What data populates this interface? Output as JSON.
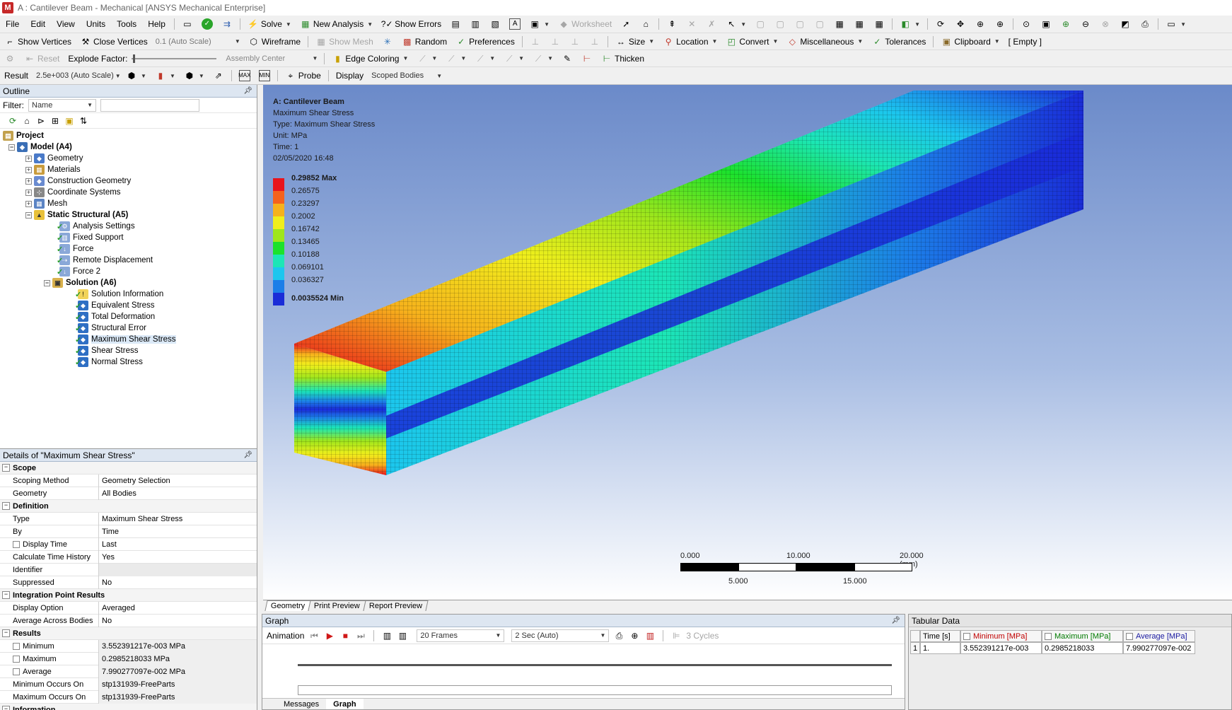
{
  "window": {
    "title": "A : Cantilever Beam - Mechanical [ANSYS Mechanical Enterprise]",
    "logo": "M"
  },
  "menubar": [
    "File",
    "Edit",
    "View",
    "Units",
    "Tools",
    "Help"
  ],
  "toolbar1": {
    "solve": "Solve",
    "new_analysis": "New Analysis",
    "show_errors": "Show Errors",
    "worksheet": "Worksheet"
  },
  "toolbar2": {
    "show_vertices": "Show Vertices",
    "close_vertices": "Close Vertices",
    "scale": "0.1 (Auto Scale)",
    "wireframe": "Wireframe",
    "show_mesh": "Show Mesh",
    "random": "Random",
    "preferences": "Preferences",
    "size": "Size",
    "location": "Location",
    "convert": "Convert",
    "misc": "Miscellaneous",
    "tolerances": "Tolerances",
    "clipboard": "Clipboard",
    "empty": "[ Empty ]"
  },
  "toolbar3": {
    "reset": "Reset",
    "explode_factor": "Explode Factor:",
    "assembly_center": "Assembly Center",
    "edge_coloring": "Edge Coloring",
    "thicken": "Thicken"
  },
  "toolbar4": {
    "result_label": "Result",
    "result_scale": "2.5e+003 (Auto Scale)",
    "probe": "Probe",
    "display_label": "Display",
    "display_value": "Scoped Bodies"
  },
  "outline": {
    "header": "Outline",
    "filter_label": "Filter:",
    "filter_value": "Name",
    "tree": {
      "project": "Project",
      "model": "Model (A4)",
      "geometry": "Geometry",
      "materials": "Materials",
      "construction_geometry": "Construction Geometry",
      "coordinate_systems": "Coordinate Systems",
      "mesh": "Mesh",
      "static_structural": "Static Structural (A5)",
      "analysis_settings": "Analysis Settings",
      "fixed_support": "Fixed Support",
      "force": "Force",
      "remote_displacement": "Remote Displacement",
      "force2": "Force 2",
      "solution": "Solution (A6)",
      "solution_information": "Solution Information",
      "equivalent_stress": "Equivalent Stress",
      "total_deformation": "Total Deformation",
      "structural_error": "Structural Error",
      "maximum_shear_stress": "Maximum Shear Stress",
      "shear_stress": "Shear Stress",
      "normal_stress": "Normal Stress"
    }
  },
  "details": {
    "header": "Details of \"Maximum Shear Stress\"",
    "scope": "Scope",
    "scoping_method_k": "Scoping Method",
    "scoping_method_v": "Geometry Selection",
    "geometry_k": "Geometry",
    "geometry_v": "All Bodies",
    "definition": "Definition",
    "type_k": "Type",
    "type_v": "Maximum Shear Stress",
    "by_k": "By",
    "by_v": "Time",
    "display_time_k": "Display Time",
    "display_time_v": "Last",
    "calc_history_k": "Calculate Time History",
    "calc_history_v": "Yes",
    "identifier_k": "Identifier",
    "identifier_v": "",
    "suppressed_k": "Suppressed",
    "suppressed_v": "No",
    "ipr": "Integration Point Results",
    "display_option_k": "Display Option",
    "display_option_v": "Averaged",
    "avg_across_k": "Average Across Bodies",
    "avg_across_v": "No",
    "results": "Results",
    "minimum_k": "Minimum",
    "minimum_v": "3.552391217e-003 MPa",
    "maximum_k": "Maximum",
    "maximum_v": "0.2985218033 MPa",
    "average_k": "Average",
    "average_v": "7.990277097e-002 MPa",
    "min_occurs_k": "Minimum Occurs On",
    "min_occurs_v": "stp131939-FreeParts",
    "max_occurs_k": "Maximum Occurs On",
    "max_occurs_v": "stp131939-FreeParts",
    "information": "Information"
  },
  "viewport": {
    "title": "A: Cantilever Beam",
    "line1": "Maximum Shear Stress",
    "line2": "Type: Maximum Shear Stress",
    "line3": "Unit: MPa",
    "line4": "Time: 1",
    "line5": "02/05/2020 16:48",
    "legend": [
      {
        "label": "0.29852 Max",
        "color": "#e8141c",
        "bold": true
      },
      {
        "label": "0.26575",
        "color": "#f5621c"
      },
      {
        "label": "0.23297",
        "color": "#f6b21c"
      },
      {
        "label": "0.2002",
        "color": "#f0ee1c"
      },
      {
        "label": "0.16742",
        "color": "#9fe61c"
      },
      {
        "label": "0.13465",
        "color": "#1ce22c"
      },
      {
        "label": "0.10188",
        "color": "#1ce6b6"
      },
      {
        "label": "0.069101",
        "color": "#1cc6ee"
      },
      {
        "label": "0.036327",
        "color": "#1c7ee8"
      },
      {
        "label": "0.0035524 Min",
        "color": "#1a2cd8",
        "bold": true
      }
    ],
    "scale": {
      "t0": "0.000",
      "t1": "10.000",
      "t2": "20.000 (mm)",
      "b0": "5.000",
      "b1": "15.000"
    }
  },
  "view_tabs": [
    "Geometry",
    "Print Preview",
    "Report Preview"
  ],
  "graph": {
    "header": "Graph",
    "animation": "Animation",
    "frames": "20 Frames",
    "duration": "2 Sec (Auto)",
    "cycles": "3 Cycles",
    "tabs": [
      "Messages",
      "Graph"
    ]
  },
  "tabular": {
    "header": "Tabular Data",
    "cols": [
      "Time [s]",
      "Minimum [MPa]",
      "Maximum [MPa]",
      "Average [MPa]"
    ],
    "row": [
      "1",
      "1.",
      "3.552391217e-003",
      "0.2985218033",
      "7.990277097e-002"
    ],
    "colors": {
      "min": "#c00000",
      "max": "#007a00",
      "avg": "#1a1aa0"
    }
  }
}
